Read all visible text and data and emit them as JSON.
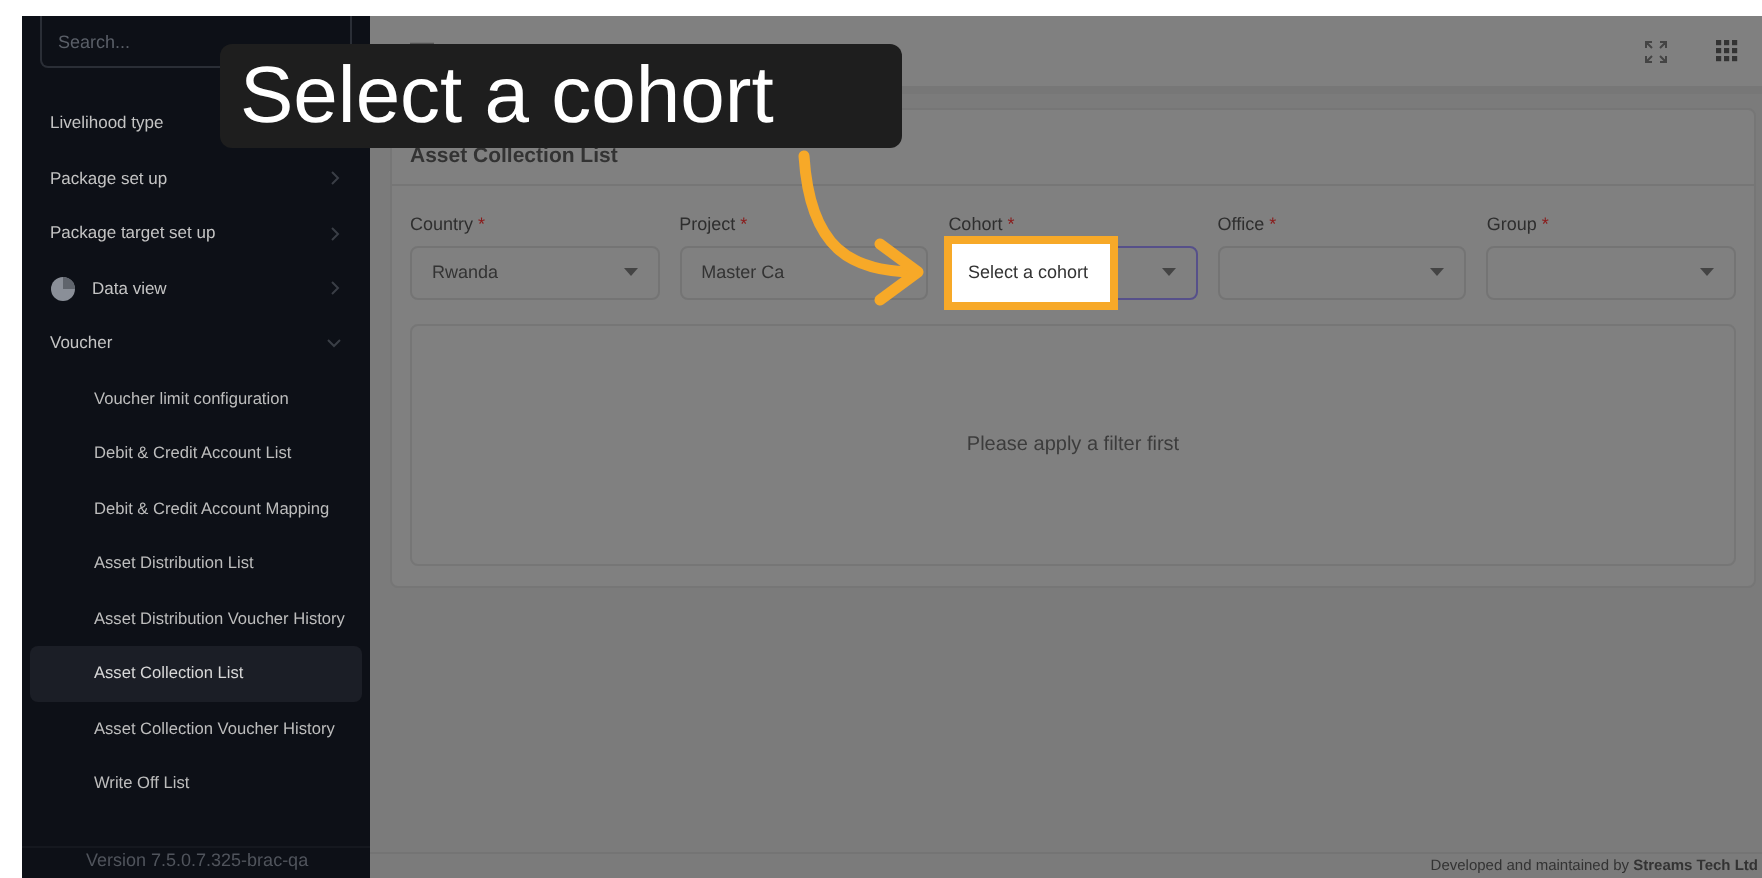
{
  "sidebar": {
    "search": {
      "placeholder": "Search..."
    },
    "items": [
      {
        "label": "Livelihood type",
        "kind": "plain",
        "selected": false
      },
      {
        "label": "Package set up",
        "kind": "expandable",
        "selected": false
      },
      {
        "label": "Package target set up",
        "kind": "expandable",
        "selected": false
      },
      {
        "label": "Data view",
        "kind": "icon",
        "selected": false
      },
      {
        "label": "Voucher",
        "kind": "expanded",
        "selected": false,
        "children": [
          {
            "label": "Voucher limit configuration",
            "selected": false
          },
          {
            "label": "Debit & Credit Account List",
            "selected": false
          },
          {
            "label": "Debit & Credit Account Mapping",
            "selected": false
          },
          {
            "label": "Asset Distribution List",
            "selected": false
          },
          {
            "label": "Asset Distribution Voucher History",
            "selected": false
          },
          {
            "label": "Asset Collection List",
            "selected": true
          },
          {
            "label": "Asset Collection Voucher History",
            "selected": false
          },
          {
            "label": "Write Off List",
            "selected": false
          }
        ]
      }
    ],
    "version": "Version 7.5.0.7.325-brac-qa"
  },
  "page": {
    "title": "Asset Collection List",
    "filters": [
      {
        "label": "Country",
        "required_mark": "*",
        "value": "Rwanda"
      },
      {
        "label": "Project",
        "required_mark": "*",
        "value": "Master Ca"
      },
      {
        "label": "Cohort",
        "required_mark": "*",
        "placeholder": "Select a cohort",
        "highlighted": true
      },
      {
        "label": "Office",
        "required_mark": "*"
      },
      {
        "label": "Group",
        "required_mark": "*"
      }
    ],
    "empty_message": "Please apply a filter first"
  },
  "footer": "Developed and maintained by **Streams Tech Ltd**",
  "callout": {
    "text": "Select a cohort"
  }
}
